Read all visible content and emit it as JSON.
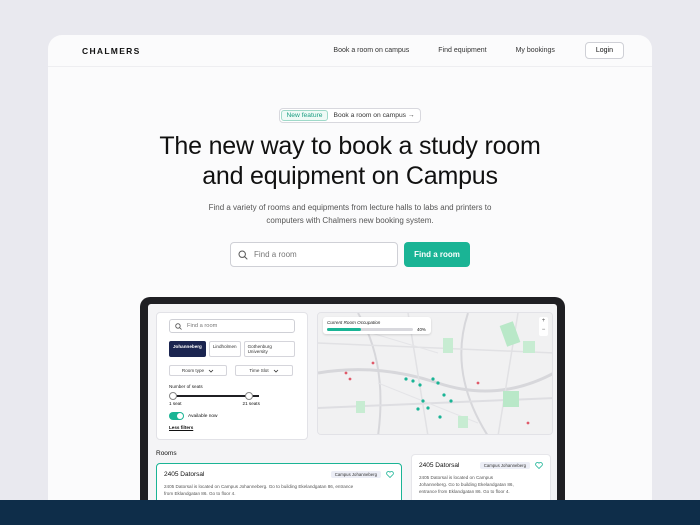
{
  "nav": {
    "logo": "CHALMERS",
    "links": [
      "Book a room on campus",
      "Find equipment",
      "My bookings"
    ],
    "login": "Login"
  },
  "hero": {
    "badge_new": "New feature",
    "badge_text": "Book a room on campus →",
    "title_line1": "The new way to book a study room",
    "title_line2": "and equipment on Campus",
    "subtitle_line1": "Find a variety of rooms and equipments from lecture halls to labs and printers to",
    "subtitle_line2": "computers with Chalmers new booking system.",
    "search_placeholder": "Find a room",
    "find_button": "Find a room"
  },
  "app": {
    "search_placeholder": "Find a room",
    "campuses": [
      "Johanneberg",
      "Lindholmen",
      "Gothenburg University"
    ],
    "selected_campus": "Johanneberg",
    "room_type": "Room type",
    "time_slot": "Time Slot",
    "seats_label": "Number of seats",
    "seats_min": "1 seat",
    "seats_max": "21 seats",
    "available_label": "Available now",
    "available_on": true,
    "less_filters": "Less filters",
    "occupancy_title": "Current Room Occupation",
    "occupancy_value": "40%",
    "occupancy_fraction": 0.4,
    "rooms_title": "Rooms",
    "rooms": [
      {
        "name": "2405 Datorsal",
        "campus": "Campus Johanneberg",
        "desc_line1": "2405 Datorsal is located on Campus Johanneberg. Go to building Ekelandgatan 86, entrance",
        "desc_line2": "from Eklandgatan 86. Go to floor 4."
      },
      {
        "name": "2405 Datorsal",
        "campus": "Campus Johanneberg",
        "desc_line1": "2405 Datorsal is located on Campus",
        "desc_line2": "Johanneberg. Go to building Ekelandgatan 86,",
        "desc_line3": "entrance from Eklandgatan 86. Go to floor 4."
      }
    ]
  },
  "colors": {
    "accent": "#1ab495",
    "navy": "#1b2550",
    "footer": "#0e2d49"
  }
}
